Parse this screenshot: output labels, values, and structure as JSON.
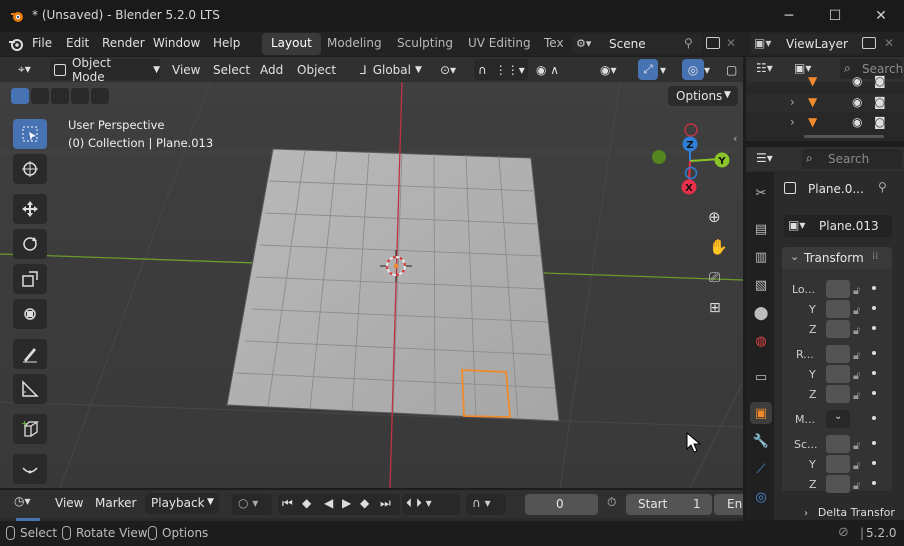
{
  "window": {
    "title": "* (Unsaved) - Blender 5.2.0 LTS",
    "minimize": "─",
    "maximize": "☐",
    "close": "✕"
  },
  "menu": [
    "File",
    "Edit",
    "Render",
    "Window",
    "Help"
  ],
  "workspaces": [
    "Layout",
    "Modeling",
    "Sculpting",
    "UV Editing",
    "Tex"
  ],
  "scene": {
    "name": "Scene"
  },
  "view_layer": {
    "name": "ViewLayer"
  },
  "viewport_header": {
    "mode": "Object Mode",
    "menus": [
      "View",
      "Select",
      "Add",
      "Object"
    ],
    "transform_orientation": "Global",
    "options": "Options"
  },
  "viewport": {
    "perspective": "User Perspective",
    "collection_info": "(0) Collection | Plane.013",
    "gizmo_axes": {
      "x": "X",
      "y": "Y",
      "z": "Z"
    }
  },
  "outliner": {
    "search_placeholder": "Search"
  },
  "properties": {
    "search_placeholder": "Search",
    "object_name_short": "Plane.0...",
    "object_name": "Plane.013",
    "panel_title": "Transform",
    "rows": [
      "Lo...",
      "Y",
      "Z",
      "R...",
      "Y",
      "Z",
      "M...",
      "Sc...",
      "Y",
      "Z"
    ],
    "subpanel": "Delta Transfor"
  },
  "timeline": {
    "menus": [
      "View",
      "Marker"
    ],
    "playback": "Playback",
    "current_frame": "0",
    "start_label": "Start",
    "start_value": "1",
    "end_label": "En"
  },
  "statusbar": {
    "select": "Select",
    "rotate_view": "Rotate View",
    "options": "Options",
    "version": "5.2.0"
  },
  "colors": {
    "accent": "#4772b3",
    "x_axis": "#e8304a",
    "y_axis": "#8ac52a",
    "z_axis": "#2f7fd9",
    "selection": "#f08a2c"
  }
}
